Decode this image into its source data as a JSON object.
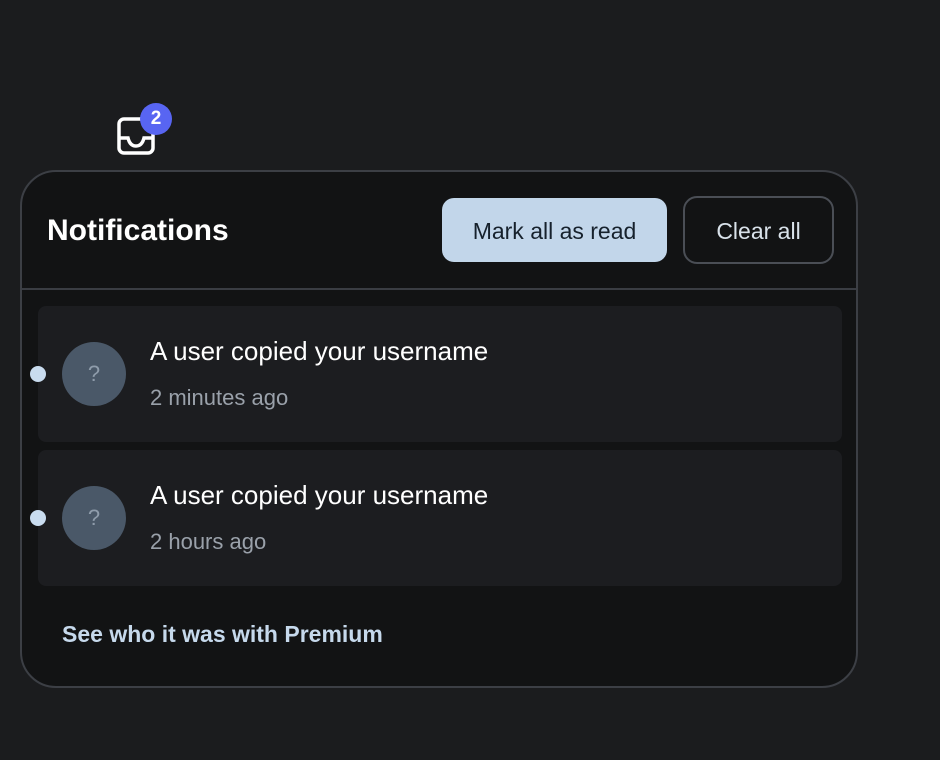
{
  "inbox": {
    "icon": "inbox-icon",
    "badge_count": "2",
    "badge_color": "#5865f2"
  },
  "panel": {
    "title": "Notifications",
    "mark_all_label": "Mark all as read",
    "clear_all_label": "Clear all",
    "accent_color": "#c2d6ea"
  },
  "notifications": [
    {
      "avatar_text": "?",
      "title": "A user copied your username",
      "time": "2 minutes ago",
      "unread": true
    },
    {
      "avatar_text": "?",
      "title": "A user copied your username",
      "time": "2 hours ago",
      "unread": true
    }
  ],
  "footer": {
    "premium_link": "See who it was with Premium"
  }
}
